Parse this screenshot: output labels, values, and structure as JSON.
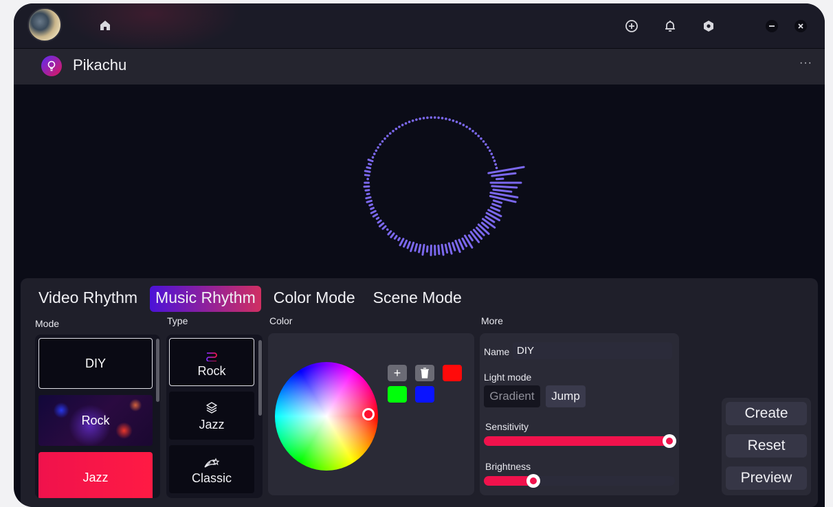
{
  "app": {
    "title": "Pikachu"
  },
  "titlebar": {
    "icons": [
      "home-icon",
      "add-circle-icon",
      "bell-icon",
      "settings-hex-icon",
      "minimize-icon",
      "close-icon"
    ]
  },
  "menu_label": "···",
  "tabs": [
    {
      "label": "Video Rhythm",
      "active": false
    },
    {
      "label": "Music Rhythm",
      "active": true
    },
    {
      "label": "Color Mode",
      "active": false
    },
    {
      "label": "Scene Mode",
      "active": false
    }
  ],
  "sections": {
    "mode": "Mode",
    "type": "Type",
    "color": "Color",
    "more": "More"
  },
  "modes": [
    {
      "label": "DIY",
      "selected": true
    },
    {
      "label": "Rock",
      "selected": false
    },
    {
      "label": "Jazz",
      "selected": false
    }
  ],
  "types": [
    {
      "label": "Rock",
      "icon": "rock-wave-icon",
      "selected": true
    },
    {
      "label": "Jazz",
      "icon": "layers-icon",
      "selected": false
    },
    {
      "label": "Classic",
      "icon": "classic-comet-icon",
      "selected": false
    }
  ],
  "color": {
    "swatches": [
      "#ff0a0a",
      "#00ff0a",
      "#0a14ff"
    ],
    "add_label": "+",
    "selected_color": "#ff1030"
  },
  "more": {
    "name_label": "Name",
    "name_value": "DIY",
    "light_mode_label": "Light mode",
    "light_modes": [
      {
        "label": "Gradient",
        "active": false
      },
      {
        "label": "Jump",
        "active": true
      }
    ],
    "sensitivity_label": "Sensitivity",
    "sensitivity_value": 1.0,
    "brightness_label": "Brightness",
    "brightness_value": 0.26
  },
  "actions": {
    "create": "Create",
    "reset": "Reset",
    "preview": "Preview"
  },
  "theme": {
    "accent": "#f0124c",
    "visualizer": "#7b68ee",
    "tab_gradient": [
      "#4b12d8",
      "#d02f62"
    ]
  }
}
